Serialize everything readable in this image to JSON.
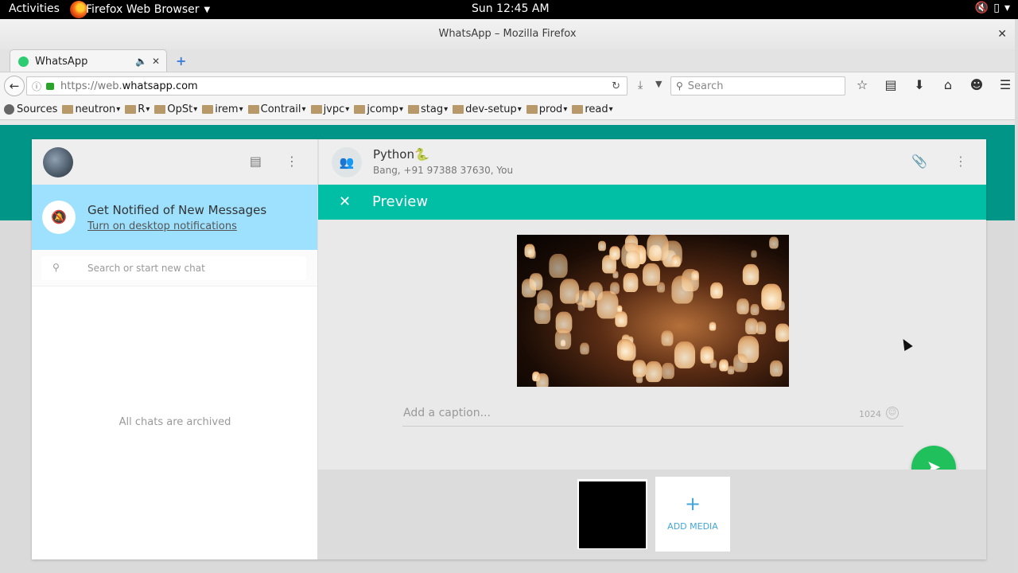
{
  "system": {
    "activities": "Activities",
    "app_menu": "Firefox Web Browser",
    "clock": "Sun 12:45 AM"
  },
  "window": {
    "title": "WhatsApp – Mozilla Firefox"
  },
  "tabs": [
    {
      "label": "WhatsApp"
    }
  ],
  "navbar": {
    "url_prefix": "https://web.",
    "url_domain": "whatsapp.com",
    "search_placeholder": "Search"
  },
  "bookmarks": [
    {
      "label": "Sources",
      "type": "globe"
    },
    {
      "label": "neutron",
      "type": "folder"
    },
    {
      "label": "R",
      "type": "folder"
    },
    {
      "label": "OpSt",
      "type": "folder"
    },
    {
      "label": "irem",
      "type": "folder"
    },
    {
      "label": "Contrail",
      "type": "folder"
    },
    {
      "label": "jvpc",
      "type": "folder"
    },
    {
      "label": "jcomp",
      "type": "folder"
    },
    {
      "label": "stag",
      "type": "folder"
    },
    {
      "label": "dev-setup",
      "type": "folder"
    },
    {
      "label": "prod",
      "type": "folder"
    },
    {
      "label": "read",
      "type": "folder"
    }
  ],
  "sidebar": {
    "notification_title": "Get Notified of New Messages",
    "notification_link": "Turn on desktop notifications",
    "search_placeholder": "Search or start new chat",
    "empty_text": "All chats are archived"
  },
  "chat": {
    "name": "Python",
    "name_emoji": "🐍",
    "members": "Bang, +91 97388 37630, You"
  },
  "preview": {
    "title": "Preview",
    "caption_placeholder": "Add a caption...",
    "caption_count": "1024",
    "add_media_label": "ADD MEDIA"
  },
  "colors": {
    "teal_band": "#019587",
    "preview_bar": "#00bfa5",
    "notif_bg": "#9de1fe",
    "send_button": "#20c15c"
  }
}
